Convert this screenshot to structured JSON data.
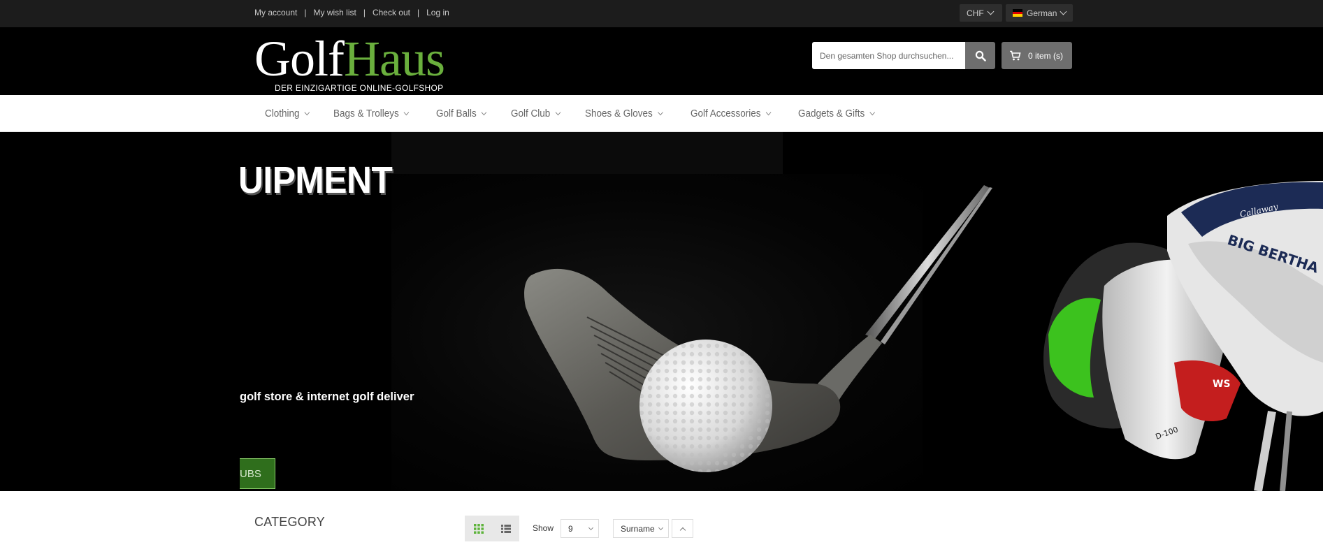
{
  "topbar": {
    "links": [
      "My account",
      "My wish list",
      "Check out",
      "Log in"
    ],
    "separator": "|",
    "currency": "CHF",
    "language": "German",
    "language_flag_colors": [
      "#000000",
      "#dd0000",
      "#ffce00"
    ]
  },
  "header": {
    "logo_part1": "Golf",
    "logo_part2": "Haus",
    "tagline": "DER EINZIGARTIGE ONLINE-GOLFSHOP",
    "search_placeholder": "Den gesamten Shop durchsuchen...",
    "cart_label": "0 item (s)"
  },
  "nav": {
    "items": [
      "Clothing",
      "Bags & Trolleys",
      "Golf Balls",
      "Golf Club",
      "Shoes & Gloves",
      "Golf Accessories",
      "Gadgets & Gifts"
    ]
  },
  "banner": {
    "headline": "UIPMENT",
    "subline": "golf store & internet golf delivery!",
    "cta": "UBS",
    "club_brand": "Callaway",
    "club_model": "BIG BERTHA",
    "club_logo": "WS",
    "club_code": "D-100"
  },
  "listing": {
    "category_title": "CATEGORY",
    "show_label": "Show",
    "show_value": "9",
    "sort_value": "Surname"
  },
  "colors": {
    "brand_green": "#6aaf3d",
    "cta_green": "#2f6e1c",
    "grid_icon_green": "#5db33a"
  }
}
